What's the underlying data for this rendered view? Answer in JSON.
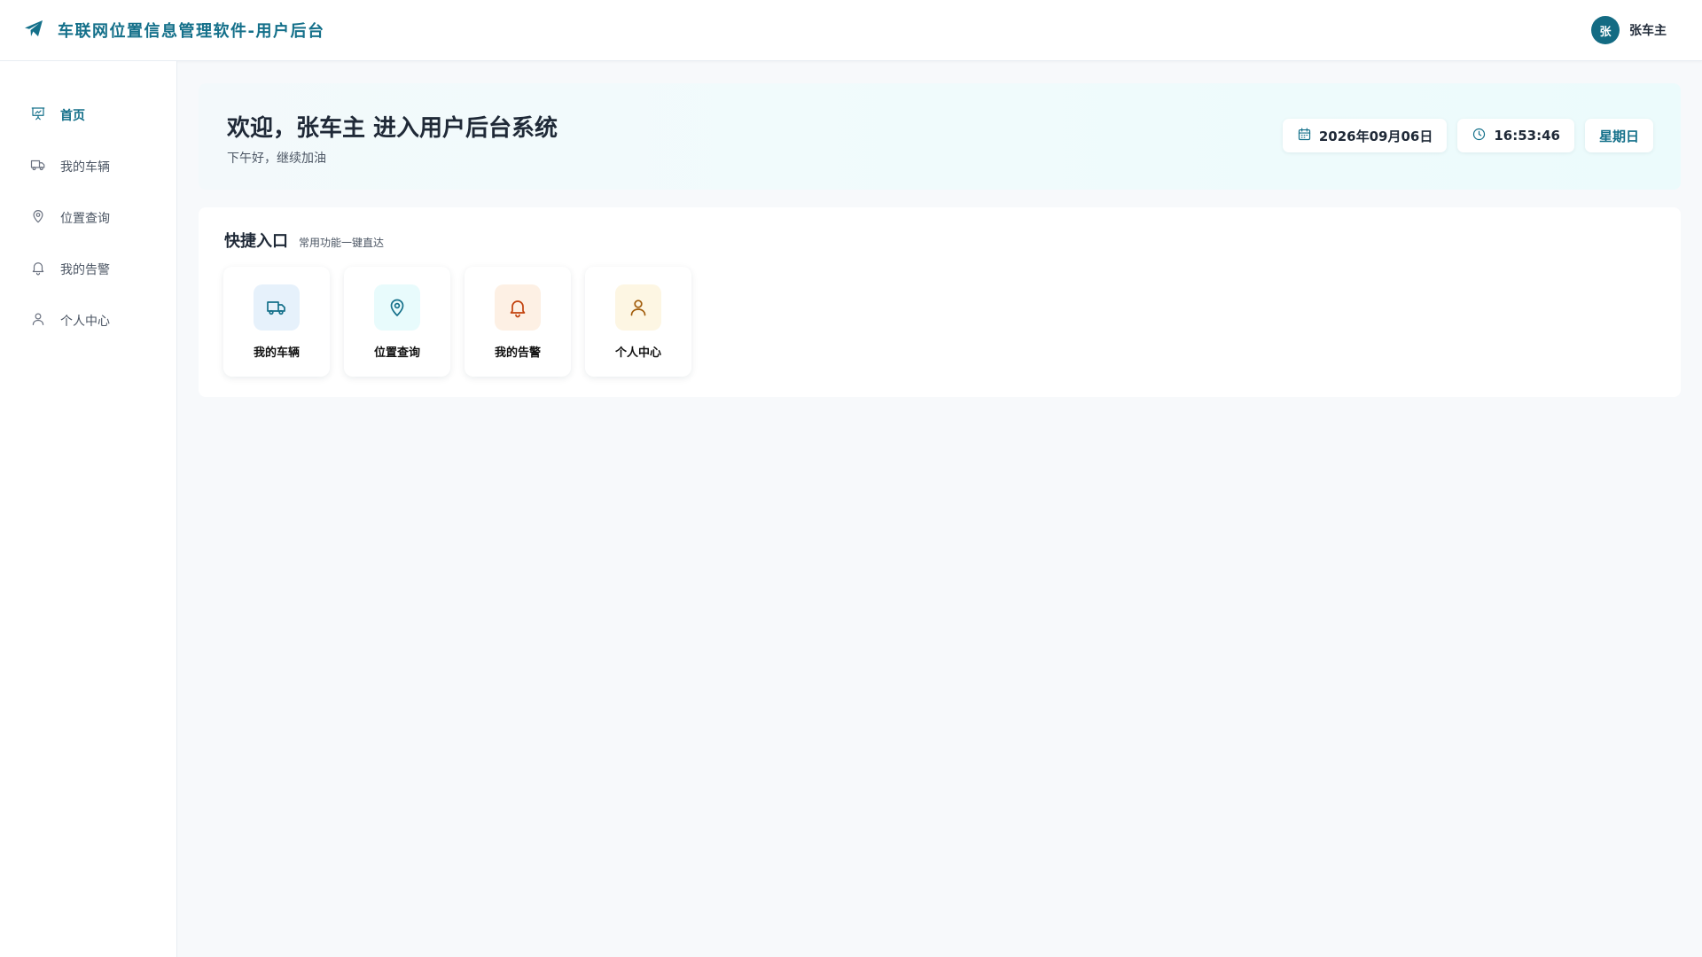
{
  "header": {
    "title": "车联网位置信息管理软件-用户后台",
    "user_avatar_text": "张",
    "user_name": "张车主",
    "brand_color": "#14708a"
  },
  "sidebar": {
    "items": [
      {
        "label": "首页",
        "icon": "presentation-chart-icon",
        "active": true
      },
      {
        "label": "我的车辆",
        "icon": "truck-icon",
        "active": false
      },
      {
        "label": "位置查询",
        "icon": "map-pin-icon",
        "active": false
      },
      {
        "label": "我的告警",
        "icon": "bell-icon",
        "active": false
      },
      {
        "label": "个人中心",
        "icon": "user-icon",
        "active": false
      }
    ]
  },
  "welcome": {
    "title": "欢迎，张车主 进入用户后台系统",
    "subtitle": "下午好，继续加油",
    "date": "2026年09月06日",
    "time": "16:53:46",
    "weekday": "星期日"
  },
  "quick": {
    "title": "快捷入口",
    "subtitle": "常用功能一键直达",
    "cards": [
      {
        "label": "我的车辆",
        "icon": "truck-icon",
        "bg": "#e6f1fb",
        "color": "#14708a"
      },
      {
        "label": "位置查询",
        "icon": "map-pin-icon",
        "bg": "#e8fbfc",
        "color": "#14708a"
      },
      {
        "label": "我的告警",
        "icon": "bell-icon",
        "bg": "#fdf0e4",
        "color": "#c2410c"
      },
      {
        "label": "个人中心",
        "icon": "user-icon",
        "bg": "#fdf6e3",
        "color": "#a15c0a"
      }
    ]
  }
}
